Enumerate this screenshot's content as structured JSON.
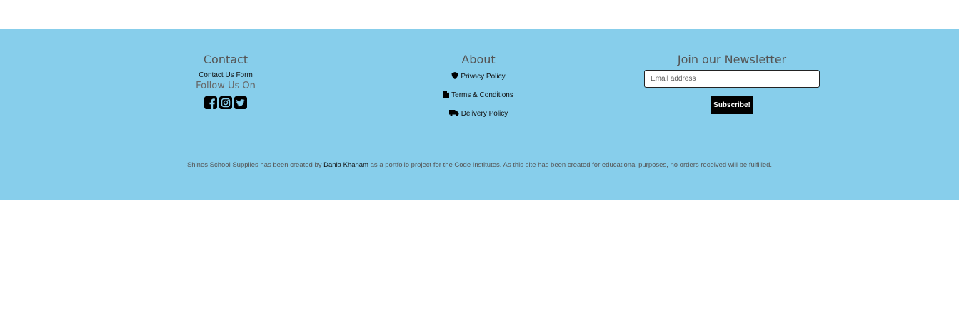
{
  "footer": {
    "contact": {
      "title": "Contact",
      "form_link": "Contact Us Form",
      "follow_label": "Follow Us On",
      "social_icons": [
        "facebook-icon",
        "instagram-icon",
        "twitter-icon"
      ]
    },
    "about": {
      "title": "About",
      "links": [
        {
          "icon": "shield-icon",
          "label": "Privacy Policy"
        },
        {
          "icon": "file-icon",
          "label": "Terms & Conditions"
        },
        {
          "icon": "truck-icon",
          "label": "Delivery Policy"
        }
      ]
    },
    "newsletter": {
      "title": "Join our Newsletter",
      "email_placeholder": "Email address",
      "email_value": "",
      "subscribe_label": "Subscribe!"
    },
    "credit": {
      "prefix": "Shines School Supplies has been created by",
      "author": "Dania Khanam",
      "suffix": "as a portfolio project for the Code Institutes. As this site has been created for educational purposes, no orders received will be fulfilled."
    },
    "colors": {
      "background": "#87ceeb",
      "button": "#000000",
      "text_muted": "#555555"
    }
  }
}
